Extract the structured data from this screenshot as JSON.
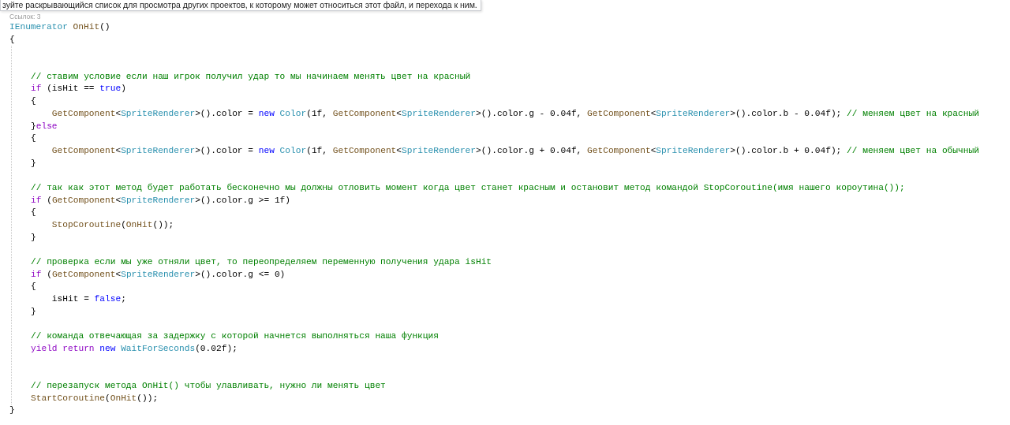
{
  "tooltip": {
    "text": "зуйте раскрывающийся список для просмотра других проектов, к которому может относиться этот файл, и перехода к ним."
  },
  "codelens": {
    "text": "Ссылок: 3"
  },
  "editor": {
    "signature": [
      {
        "kind": "type",
        "text": "IEnumerator "
      },
      {
        "kind": "method",
        "text": "OnHit"
      },
      {
        "kind": "plain",
        "text": "()"
      }
    ],
    "open": "{",
    "body": [
      {
        "kind": "blank"
      },
      {
        "kind": "blank"
      },
      {
        "kind": "code",
        "tokens": [
          {
            "kind": "comment",
            "text": "// ставим условие если наш игрок получил удар то мы начинаем менять цвет на красный"
          }
        ]
      },
      {
        "kind": "code",
        "tokens": [
          {
            "kind": "control",
            "text": "if"
          },
          {
            "kind": "plain",
            "text": " (isHit == "
          },
          {
            "kind": "keyword",
            "text": "true"
          },
          {
            "kind": "plain",
            "text": ")"
          }
        ]
      },
      {
        "kind": "code",
        "tokens": [
          {
            "kind": "plain",
            "text": "{"
          }
        ]
      },
      {
        "kind": "code",
        "tokens": [
          {
            "kind": "method",
            "text": "    GetComponent"
          },
          {
            "kind": "plain",
            "text": "<"
          },
          {
            "kind": "type",
            "text": "SpriteRenderer"
          },
          {
            "kind": "plain",
            "text": ">().color = "
          },
          {
            "kind": "keyword",
            "text": "new "
          },
          {
            "kind": "type",
            "text": "Color"
          },
          {
            "kind": "plain",
            "text": "(1f, "
          },
          {
            "kind": "method",
            "text": "GetComponent"
          },
          {
            "kind": "plain",
            "text": "<"
          },
          {
            "kind": "type",
            "text": "SpriteRenderer"
          },
          {
            "kind": "plain",
            "text": ">().color.g - 0.04f, "
          },
          {
            "kind": "method",
            "text": "GetComponent"
          },
          {
            "kind": "plain",
            "text": "<"
          },
          {
            "kind": "type",
            "text": "SpriteRenderer"
          },
          {
            "kind": "plain",
            "text": ">().color.b - 0.04f); "
          },
          {
            "kind": "comment",
            "text": "// меняем цвет на красный"
          }
        ]
      },
      {
        "kind": "code",
        "tokens": [
          {
            "kind": "plain",
            "text": "}"
          },
          {
            "kind": "control",
            "text": "else"
          }
        ]
      },
      {
        "kind": "code",
        "tokens": [
          {
            "kind": "plain",
            "text": "{"
          }
        ]
      },
      {
        "kind": "code",
        "tokens": [
          {
            "kind": "method",
            "text": "    GetComponent"
          },
          {
            "kind": "plain",
            "text": "<"
          },
          {
            "kind": "type",
            "text": "SpriteRenderer"
          },
          {
            "kind": "plain",
            "text": ">().color = "
          },
          {
            "kind": "keyword",
            "text": "new "
          },
          {
            "kind": "type",
            "text": "Color"
          },
          {
            "kind": "plain",
            "text": "(1f, "
          },
          {
            "kind": "method",
            "text": "GetComponent"
          },
          {
            "kind": "plain",
            "text": "<"
          },
          {
            "kind": "type",
            "text": "SpriteRenderer"
          },
          {
            "kind": "plain",
            "text": ">().color.g + 0.04f, "
          },
          {
            "kind": "method",
            "text": "GetComponent"
          },
          {
            "kind": "plain",
            "text": "<"
          },
          {
            "kind": "type",
            "text": "SpriteRenderer"
          },
          {
            "kind": "plain",
            "text": ">().color.b + 0.04f); "
          },
          {
            "kind": "comment",
            "text": "// меняем цвет на обычный"
          }
        ]
      },
      {
        "kind": "code",
        "tokens": [
          {
            "kind": "plain",
            "text": "}"
          }
        ]
      },
      {
        "kind": "blank"
      },
      {
        "kind": "code",
        "tokens": [
          {
            "kind": "comment",
            "text": "// так как этот метод будет работать бесконечно мы должны отловить момент когда цвет станет красным и остановит метод командой StopCoroutine(имя нашего короутина());"
          }
        ]
      },
      {
        "kind": "code",
        "tokens": [
          {
            "kind": "control",
            "text": "if"
          },
          {
            "kind": "plain",
            "text": " ("
          },
          {
            "kind": "method",
            "text": "GetComponent"
          },
          {
            "kind": "plain",
            "text": "<"
          },
          {
            "kind": "type",
            "text": "SpriteRenderer"
          },
          {
            "kind": "plain",
            "text": ">().color.g >= 1f)"
          }
        ]
      },
      {
        "kind": "code",
        "tokens": [
          {
            "kind": "plain",
            "text": "{"
          }
        ]
      },
      {
        "kind": "code",
        "tokens": [
          {
            "kind": "method",
            "text": "    StopCoroutine"
          },
          {
            "kind": "plain",
            "text": "("
          },
          {
            "kind": "method",
            "text": "OnHit"
          },
          {
            "kind": "plain",
            "text": "());"
          }
        ]
      },
      {
        "kind": "code",
        "tokens": [
          {
            "kind": "plain",
            "text": "}"
          }
        ]
      },
      {
        "kind": "blank"
      },
      {
        "kind": "code",
        "tokens": [
          {
            "kind": "comment",
            "text": "// проверка если мы уже отняли цвет, то переопределяем переменную получения удара isHit"
          }
        ]
      },
      {
        "kind": "code",
        "tokens": [
          {
            "kind": "control",
            "text": "if"
          },
          {
            "kind": "plain",
            "text": " ("
          },
          {
            "kind": "method",
            "text": "GetComponent"
          },
          {
            "kind": "plain",
            "text": "<"
          },
          {
            "kind": "type",
            "text": "SpriteRenderer"
          },
          {
            "kind": "plain",
            "text": ">().color.g <= 0)"
          }
        ]
      },
      {
        "kind": "code",
        "tokens": [
          {
            "kind": "plain",
            "text": "{"
          }
        ]
      },
      {
        "kind": "code",
        "tokens": [
          {
            "kind": "plain",
            "text": "    isHit = "
          },
          {
            "kind": "keyword",
            "text": "false"
          },
          {
            "kind": "plain",
            "text": ";"
          }
        ]
      },
      {
        "kind": "code",
        "tokens": [
          {
            "kind": "plain",
            "text": "}"
          }
        ]
      },
      {
        "kind": "blank"
      },
      {
        "kind": "code",
        "tokens": [
          {
            "kind": "comment",
            "text": "// команда отвечающая за задержку с которой начнется выполняться наша функция"
          }
        ]
      },
      {
        "kind": "code",
        "tokens": [
          {
            "kind": "control",
            "text": "yield return "
          },
          {
            "kind": "keyword",
            "text": "new "
          },
          {
            "kind": "type",
            "text": "WaitForSeconds"
          },
          {
            "kind": "plain",
            "text": "(0.02f);"
          }
        ]
      },
      {
        "kind": "blank"
      },
      {
        "kind": "blank"
      },
      {
        "kind": "code",
        "tokens": [
          {
            "kind": "comment",
            "text": "// перезапуск метода OnHit() чтобы улавливать, нужно ли менять цвет"
          }
        ]
      },
      {
        "kind": "code",
        "tokens": [
          {
            "kind": "method",
            "text": "StartCoroutine"
          },
          {
            "kind": "plain",
            "text": "("
          },
          {
            "kind": "method",
            "text": "OnHit"
          },
          {
            "kind": "plain",
            "text": "());"
          }
        ]
      }
    ],
    "close": "}"
  }
}
